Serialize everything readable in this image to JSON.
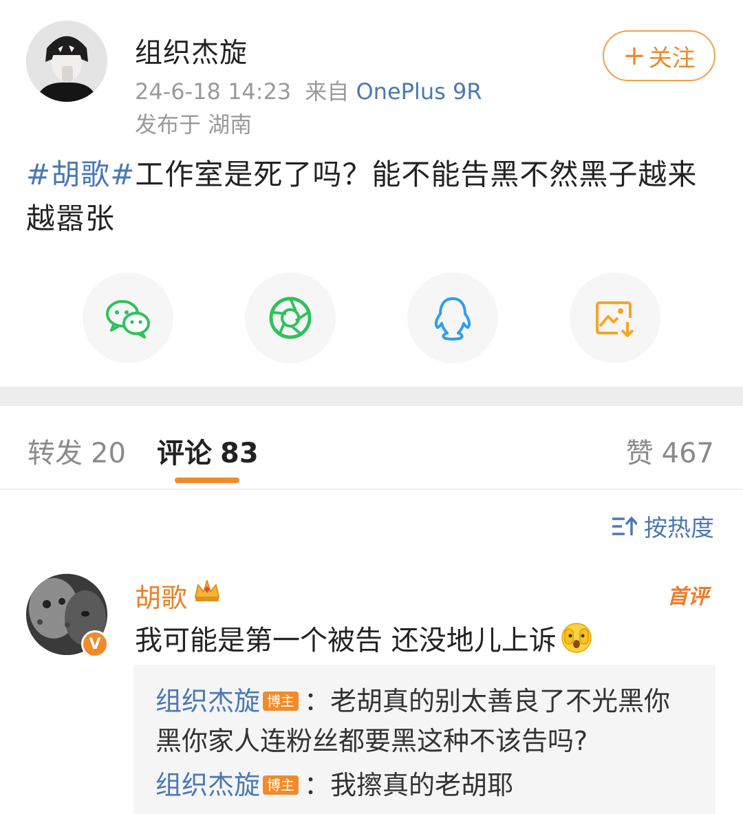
{
  "post": {
    "author": "组织杰旋",
    "time": "24-6-18 14:23",
    "source_prefix": "来自",
    "device": "OnePlus 9R",
    "location": "发布于 湖南",
    "follow_plus": "+",
    "follow_label": "关注",
    "topic": "#胡歌#",
    "text": "工作室是死了吗？能不能告黑不然黑子越来越嚣张"
  },
  "share": [
    {
      "icon": "wechat-icon",
      "color": "#2fc15c"
    },
    {
      "icon": "moments-icon",
      "color": "#2fc15c"
    },
    {
      "icon": "qq-icon",
      "color": "#2e9df0"
    },
    {
      "icon": "save-image-icon",
      "color": "#f5a623"
    }
  ],
  "tabs": {
    "repost_label": "转发",
    "repost_count": "20",
    "comment_label": "评论",
    "comment_count": "83",
    "like_label": "赞",
    "like_count": "467"
  },
  "sort": {
    "label": "按热度"
  },
  "comment": {
    "name": "胡歌",
    "verified": "V",
    "tag": "首评",
    "text": "我可能是第一个被告 还没地儿上诉",
    "replies": [
      {
        "user": "组织杰旋",
        "badge": "博主",
        "sep": "：",
        "text": "老胡真的别太善良了不光黑你黑你家人连粉丝都要黑这种不该告吗?"
      },
      {
        "user": "组织杰旋",
        "badge": "博主",
        "sep": "：",
        "text": "我擦真的老胡耶"
      }
    ]
  }
}
